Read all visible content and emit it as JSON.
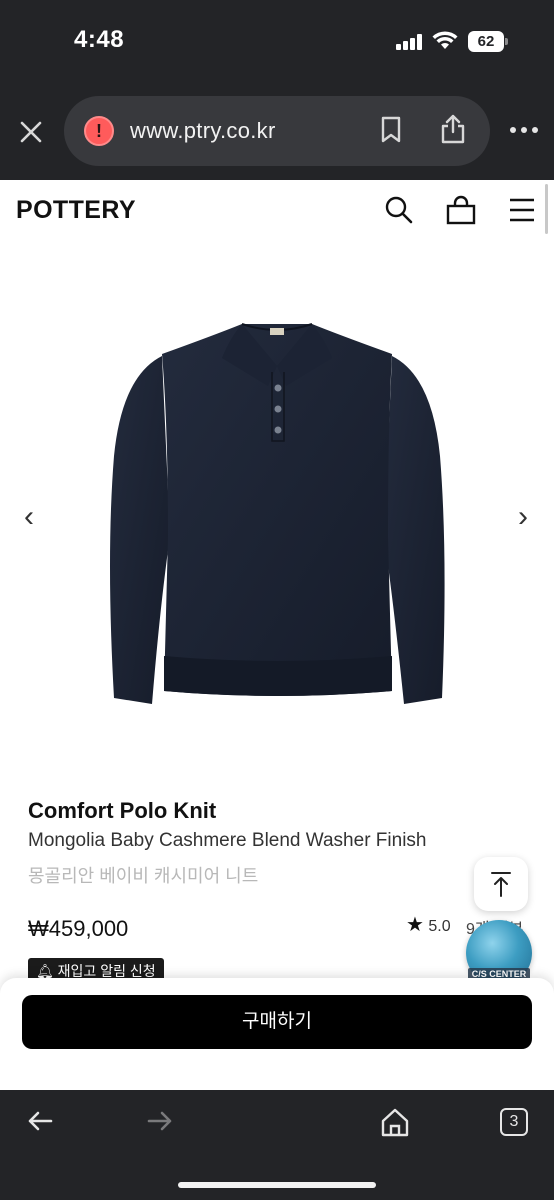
{
  "status_bar": {
    "time": "4:48",
    "battery": "62"
  },
  "browser": {
    "url": "www.ptry.co.kr",
    "tab_count": "3"
  },
  "site": {
    "logo": "POTTERY"
  },
  "product": {
    "name": "Comfort Polo Knit",
    "subtitle": "Mongolia Baby Cashmere Blend Washer Finish",
    "korean_name": "몽골리안 베이비 캐시미어 니트",
    "price": "₩459,000",
    "rating": "5.0",
    "reviews": "9개 리뷰",
    "restock_label": "재입고 알림 신청",
    "color": "#1b2233"
  },
  "carousel": {
    "prev": "‹",
    "next": "›"
  },
  "floating": {
    "cs_label": "C/S CENTER"
  },
  "buy": {
    "label": "구매하기"
  },
  "colors": {
    "chrome": "#232427",
    "accent": "#000000",
    "warning": "#ff5b5b"
  },
  "icons": [
    "close-icon",
    "warning-icon",
    "bookmark-icon",
    "share-icon",
    "more-icon",
    "search-icon",
    "bag-icon",
    "menu-icon",
    "back-icon",
    "forward-icon",
    "home-icon",
    "arrow-up-icon"
  ]
}
